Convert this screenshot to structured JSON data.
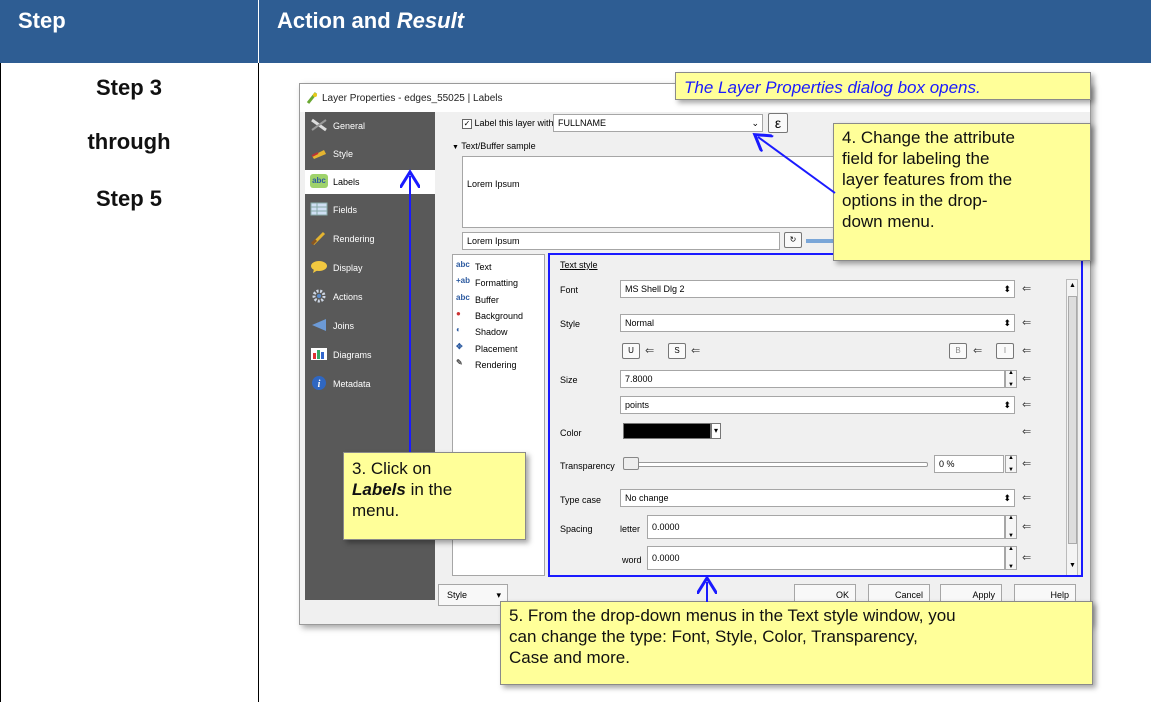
{
  "header": {
    "step_label": "Step",
    "action_label": "Action and",
    "action_label_italic": "Result"
  },
  "steps": {
    "line1": "Step 3",
    "line2": "through",
    "line3": "Step 5"
  },
  "dialog": {
    "title": "Layer Properties - edges_55025 | Labels",
    "sidebar": [
      {
        "label": "General",
        "icon": "tools-icon"
      },
      {
        "label": "Style",
        "icon": "brush-icon"
      },
      {
        "label": "Labels",
        "icon": "abc-label-icon"
      },
      {
        "label": "Fields",
        "icon": "table-icon"
      },
      {
        "label": "Rendering",
        "icon": "paint-brush-icon"
      },
      {
        "label": "Display",
        "icon": "speech-bubble-icon"
      },
      {
        "label": "Actions",
        "icon": "gear-icon"
      },
      {
        "label": "Joins",
        "icon": "join-icon"
      },
      {
        "label": "Diagrams",
        "icon": "chart-icon"
      },
      {
        "label": "Metadata",
        "icon": "info-icon"
      }
    ],
    "label_checkbox": "Label this layer with",
    "label_field": "FULLNAME",
    "expr_button": "ε",
    "sample_section": "Text/Buffer sample",
    "sample_text": "Lorem Ipsum",
    "sample_input": "Lorem Ipsum",
    "sublist": [
      {
        "label": "Text",
        "icon": "abc"
      },
      {
        "label": "Formatting",
        "icon": "+ab"
      },
      {
        "label": "Buffer",
        "icon": "abc"
      },
      {
        "label": "Background",
        "icon": "●"
      },
      {
        "label": "Shadow",
        "icon": "◐"
      },
      {
        "label": "Placement",
        "icon": "✥"
      },
      {
        "label": "Rendering",
        "icon": "✎"
      }
    ],
    "text_style": {
      "heading": "Text style",
      "font_label": "Font",
      "font_value": "MS Shell Dlg 2",
      "style_label": "Style",
      "style_value": "Normal",
      "u_btn": "U",
      "s_btn": "S",
      "b_btn": "B",
      "i_btn": "I",
      "size_label": "Size",
      "size_value": "7.8000",
      "size_unit": "points",
      "color_label": "Color",
      "color_value": "#000000",
      "transparency_label": "Transparency",
      "transparency_value": "0 %",
      "transparency_fraction": 0,
      "case_label": "Type case",
      "case_value": "No change",
      "spacing_label": "Spacing",
      "letter_label": "letter",
      "letter_value": "0.0000",
      "word_label": "word",
      "word_value": "0.0000"
    },
    "footer": {
      "style_button": "Style",
      "ok": "OK",
      "cancel": "Cancel",
      "apply": "Apply",
      "help": "Help"
    }
  },
  "callouts": {
    "top": "The Layer Properties dialog box opens.",
    "c4": [
      "4. Change the attribute",
      "field for labeling the",
      "layer features from the",
      "options in the drop-",
      "down menu."
    ],
    "c3_line1": "3. Click on",
    "c3_bold": "Labels",
    "c3_rest": " in the",
    "c3_line3": "menu.",
    "c5": [
      "5. From the drop-down menus in the Text style window, you",
      "can change the type: Font, Style, Color, Transparency,",
      "Case and more."
    ]
  },
  "colors": {
    "header_bg": "#2e5d93",
    "callout_bg": "#ffff99",
    "highlight": "#1a1aff",
    "sidebar_bg": "#595959"
  }
}
